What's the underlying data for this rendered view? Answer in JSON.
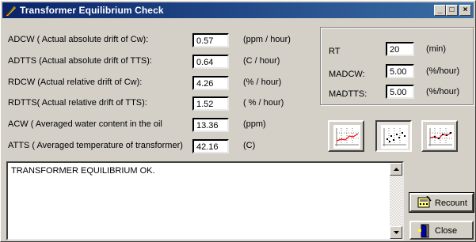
{
  "window": {
    "title": "Transformer Equilibrium Check"
  },
  "title_buttons": {
    "minimize": "_",
    "maximize": "□",
    "close": "×"
  },
  "params": [
    {
      "label": "ADCW ( Actual absolute drift of Cw):",
      "value": "0.57",
      "unit": "(ppm / hour)"
    },
    {
      "label": "ADTTS (Actual absolute drift of TTS):",
      "value": "0.64",
      "unit": "(C / hour)"
    },
    {
      "label": "RDCW (Actual relative drift of Cw):",
      "value": "4.26",
      "unit": "(% / hour)"
    },
    {
      "label": "RDTTS( Actual relative drift of TTS):",
      "value": "1.52",
      "unit": "( % / hour)"
    },
    {
      "label": "ACW ( Averaged water content in the oil",
      "value": "13.36",
      "unit": "(ppm)"
    },
    {
      "label": "ATTS ( Averaged temperature of transformer)",
      "value": "42.16",
      "unit": "(C)"
    }
  ],
  "settings": [
    {
      "label": "RT",
      "value": "20",
      "unit": "(min)"
    },
    {
      "label": "MADCW:",
      "value": "5.00",
      "unit": "(%/hour)"
    },
    {
      "label": "MADTTS:",
      "value": "5.00",
      "unit": "(%/hour)"
    }
  ],
  "chart_buttons": [
    {
      "icon": "line-chart-icon",
      "pressed": false
    },
    {
      "icon": "scatter-chart-icon",
      "pressed": true
    },
    {
      "icon": "line-scatter-chart-icon",
      "pressed": false
    }
  ],
  "memo": {
    "text": "TRANSFORMER EQUILIBRIUM OK."
  },
  "buttons": {
    "recount": "Recount",
    "close": "Close"
  },
  "colors": {
    "title_start": "#0a246a",
    "title_end": "#3a6ea5",
    "face": "#d4d0c8",
    "chart_line": "#ff0000"
  }
}
